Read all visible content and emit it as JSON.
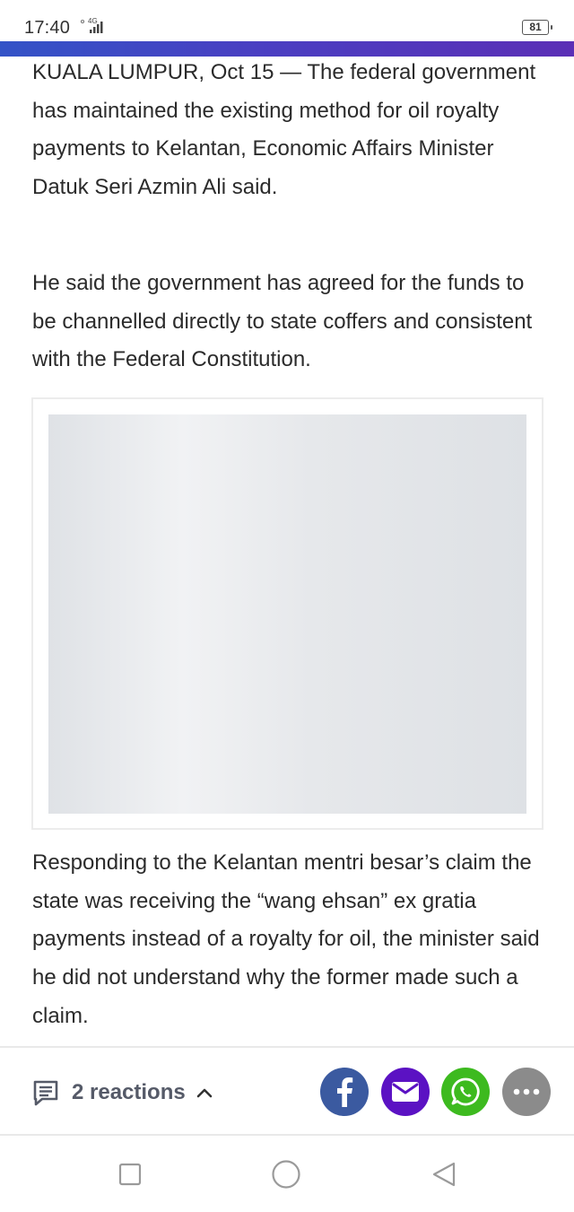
{
  "status_bar": {
    "time": "17:40",
    "network": "4G",
    "battery": "81",
    "signal_icon": "signal-bars-icon",
    "battery_icon": "battery-icon"
  },
  "colors": {
    "accent_bar_start": "#3353c7",
    "accent_bar_end": "#5b2fb6",
    "facebook": "#3b5aa0",
    "email": "#5b12c3",
    "whatsapp": "#3dba1f",
    "more": "#8b8b8b",
    "reaction_text": "#555a68"
  },
  "article": {
    "paragraphs": [
      "KUALA LUMPUR, Oct 15 — The federal government has maintained the existing method for oil royalty payments to Kelantan, Economic Affairs Minister Datuk Seri Azmin Ali said.",
      "He said the government has agreed for the funds to be channelled directly to state coffers and consistent with the Federal Constitution.",
      "Responding to the Kelantan mentri besar’s claim the state was receiving the “wang ehsan” ex gratia payments instead of a royalty for oil, the minister said he did not understand why the former made such a claim."
    ]
  },
  "footer": {
    "reactions_label": "2 reactions",
    "reactions_icon": "comment-icon",
    "toggle_icon": "chevron-up-icon",
    "share": [
      {
        "name": "facebook",
        "icon": "facebook-icon"
      },
      {
        "name": "email",
        "icon": "envelope-icon"
      },
      {
        "name": "whatsapp",
        "icon": "whatsapp-icon"
      },
      {
        "name": "more",
        "icon": "more-dots-icon"
      }
    ]
  },
  "nav_bar": {
    "buttons": [
      "recent-apps-icon",
      "home-icon",
      "back-icon"
    ]
  }
}
